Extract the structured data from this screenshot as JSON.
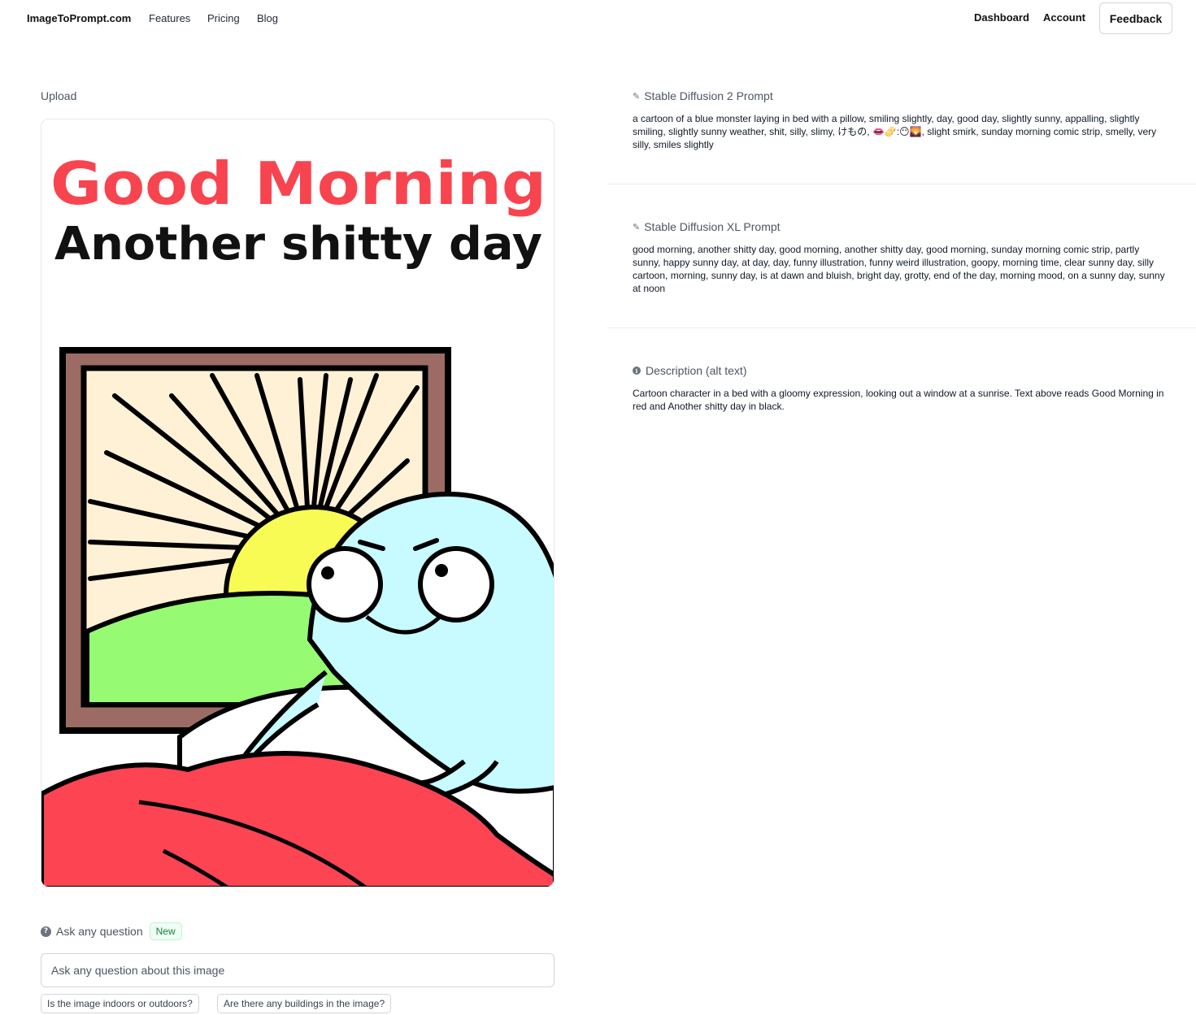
{
  "nav": {
    "brand": "ImageToPrompt.com",
    "links": [
      "Features",
      "Pricing",
      "Blog"
    ],
    "right_links": [
      "Dashboard",
      "Account"
    ],
    "feedback_label": "Feedback"
  },
  "upload": {
    "label": "Upload",
    "image": {
      "headline": "Good Morning",
      "subline": "Another shitty day",
      "headline_color": "#f8444f",
      "subline_color": "#111111"
    }
  },
  "ask": {
    "icon": "question-circle-icon",
    "title": "Ask any question",
    "badge": "New",
    "placeholder": "Ask any question about this image",
    "suggestions": [
      "Is the image indoors or outdoors?",
      "Are there any buildings in the image?"
    ]
  },
  "sections": [
    {
      "icon": "brush-icon",
      "title": "Stable Diffusion 2 Prompt",
      "text": "a cartoon of a blue monster laying in bed with a pillow, smiling slightly, day, good day, slightly sunny, appalling, slightly smiling, slightly sunny weather, shit, silly, slimy, けもの, 👄🫔:😶🌄, slight smirk, sunday morning comic strip, smelly, very silly, smiles slightly"
    },
    {
      "icon": "brush-icon",
      "title": "Stable Diffusion XL Prompt",
      "text": "good morning, another shitty day, good morning, another shitty day, good morning, sunday morning comic strip, partly sunny, happy sunny day, at day, day, funny illustration, funny weird illustration, goopy, morning time, clear sunny day, silly cartoon, morning, sunny day, is at dawn and bluish, bright day, grotty, end of the day, morning mood, on a sunny day, sunny at noon"
    },
    {
      "icon": "info-circle-icon",
      "title": "Description (alt text)",
      "text": "Cartoon character in a bed with a gloomy expression, looking out a window at a sunrise. Text above reads Good Morning in red and Another shitty day in black."
    }
  ]
}
